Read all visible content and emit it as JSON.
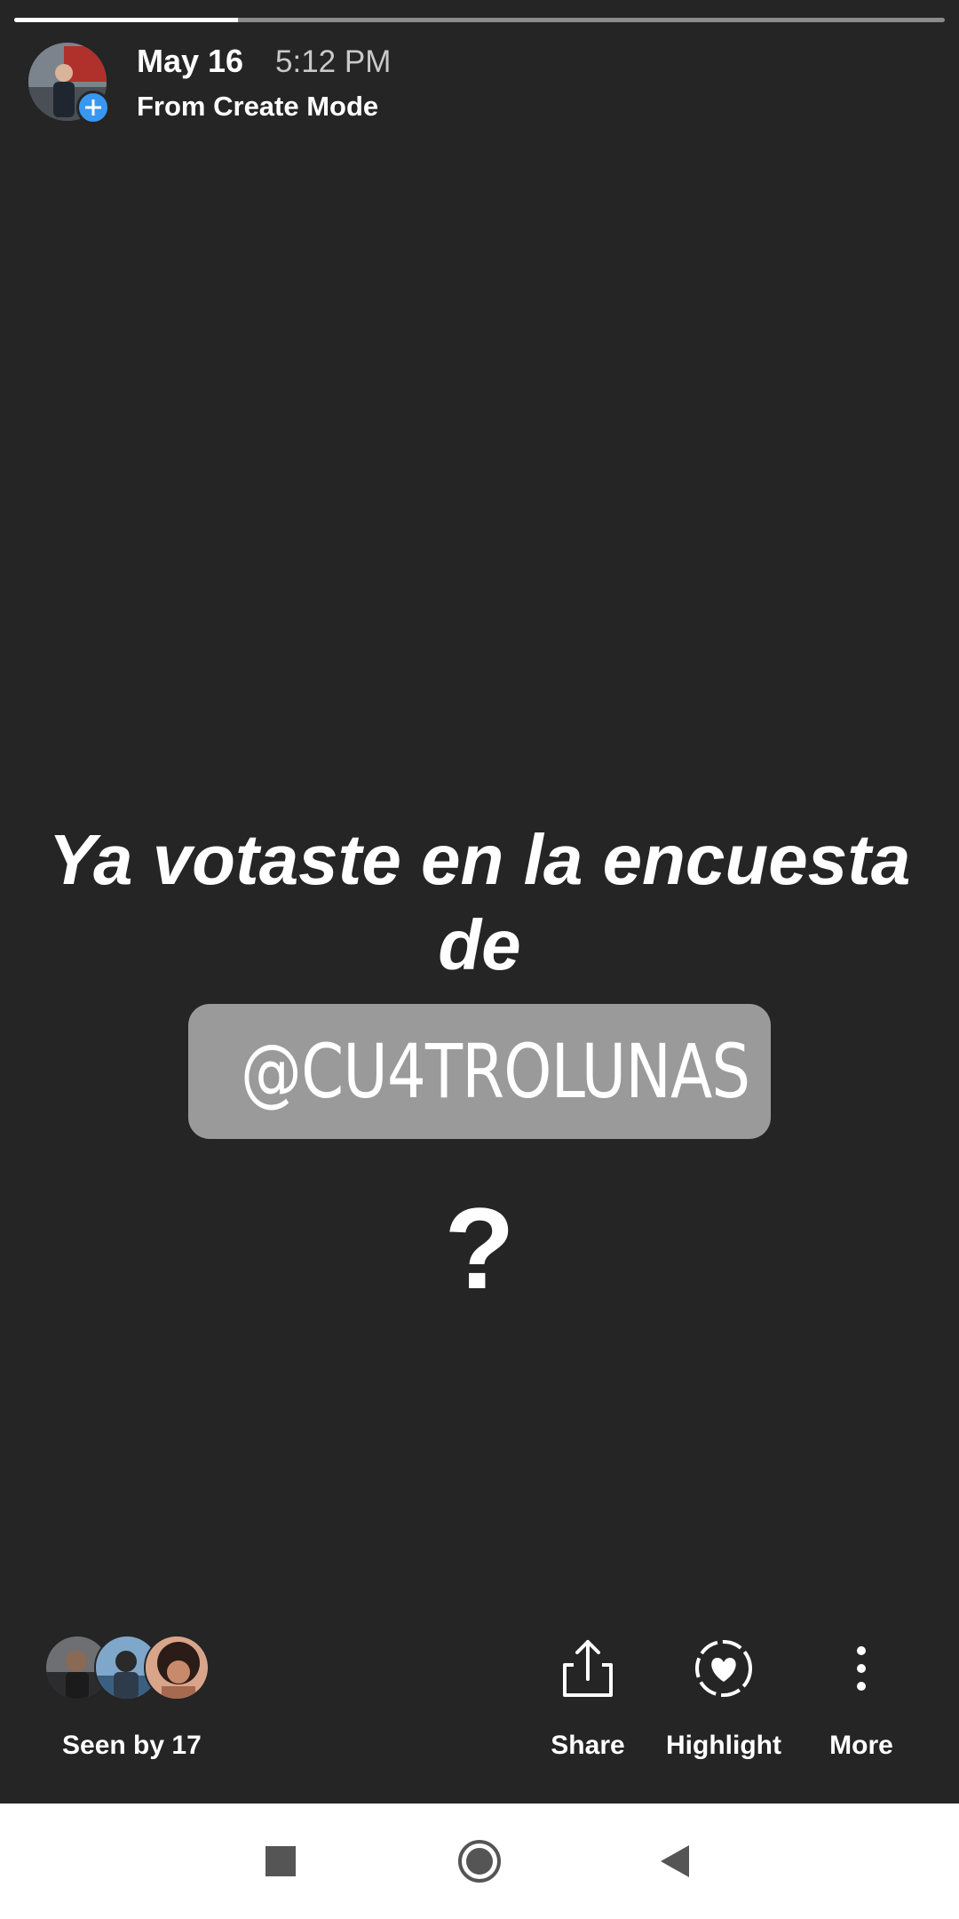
{
  "progress": {
    "fraction": 0.24
  },
  "header": {
    "date": "May 16",
    "time": "5:12 PM",
    "source": "From Create Mode",
    "avatar_icon": "profile-photo",
    "add_icon": "plus-circle-icon"
  },
  "story": {
    "text": "Ya votaste en la encuesta de",
    "mention": "@CU4TROLUNAS",
    "question": "?"
  },
  "footer": {
    "seen_by": "Seen by 17",
    "actions": [
      {
        "label": "Share",
        "icon": "share-icon"
      },
      {
        "label": "Highlight",
        "icon": "highlight-heart-icon"
      },
      {
        "label": "More",
        "icon": "more-vertical-icon"
      }
    ]
  },
  "nav": {
    "buttons": [
      "recents-icon",
      "home-icon",
      "back-icon"
    ]
  },
  "colors": {
    "background": "#252525",
    "accent": "#3897f0",
    "mention_bg": "#9a9a9a",
    "navbar": "#ffffff"
  }
}
